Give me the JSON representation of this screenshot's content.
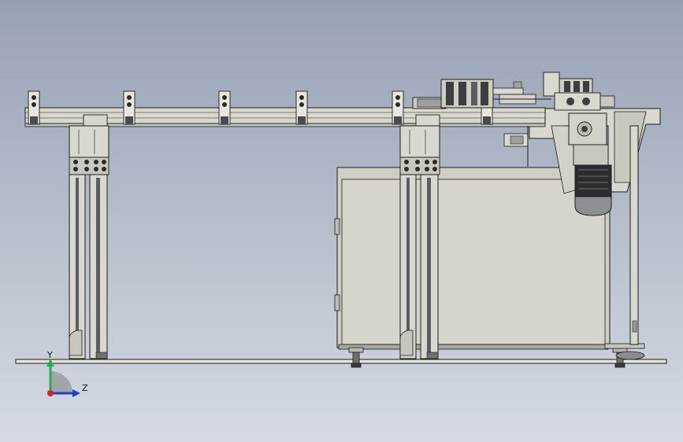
{
  "viewport": {
    "background_top": "#97a1b4",
    "background_bottom": "#d5dae2"
  },
  "triad": {
    "y_label": "Y",
    "z_label": "Z",
    "y_color": "#22b14c",
    "z_color": "#1f3fd6",
    "x_color": "#e02020"
  },
  "model": {
    "frame_color": "#d9d8cf",
    "cabinet_color": "#cfcec3",
    "outline_color": "#1c1c1c",
    "motor_color": "#8d8f93"
  }
}
